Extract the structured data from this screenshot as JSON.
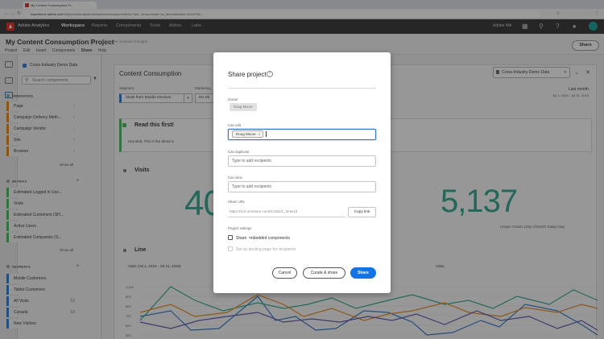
{
  "browser": {
    "tab_title": "My Content Consumption Pr...",
    "url_host": "experience.adobe.com",
    "url_rest": "/#/@adobeanalytics/analytics/workspace/edit/5c74bd...&reportsuite=sc_demodata&ch=5c2a7f3e..."
  },
  "topnav": {
    "brand": "Adobe Analytics",
    "items": [
      "Workspace",
      "Reports",
      "Components",
      "Tools",
      "Admin",
      "Labs"
    ],
    "org": "Adobe MA"
  },
  "project": {
    "title": "My Content Consumption Project",
    "subtitle": "There are unsaved changes",
    "menus": [
      "Project",
      "Edit",
      "Insert",
      "Components",
      "Share",
      "Help"
    ],
    "share_label": "Share"
  },
  "panel": {
    "report_suite": "Cross-Industry Demo Data",
    "search_placeholder": "Search components",
    "dimensions_head": "DIMENSIONS",
    "dimensions": [
      "Page",
      "Campaign Delivery Meth...",
      "Campaign Vendor",
      "Site",
      "Browser"
    ],
    "metrics_head": "METRICS",
    "metrics": [
      "Estimated Logged in Use...",
      "Visits",
      "Estimated Customers (SH...",
      "Active Users",
      "Estimated Companies (S..."
    ],
    "segments_head": "SEGMENTS",
    "segments": [
      "Mobile Customers",
      "Tablet Customers",
      "All Visits",
      "Canada",
      "New Visitors"
    ],
    "segment_counts": [
      "",
      "",
      "53",
      "53",
      ""
    ],
    "show_all": "Show all"
  },
  "freeform": {
    "title": "Content Consumption",
    "segment_label": "Segment",
    "segment_value": "Visits from Mobile Devices",
    "segment2_label": "Marketing",
    "segment2_value": "No Sh",
    "report_suite": "Cross-Industry Demo Data",
    "date_label": "Last month",
    "date_sub": "Jul 1, 2019 - Jul 31, 2019",
    "read_first_title": "Read this first!",
    "read_first_body": "Hey Bob,  This is the about a",
    "visits_title": "Visits",
    "big_left": "40",
    "big_right": "5,137",
    "big_right_sub": "Unique Visitors (Day of Month Today)  Day",
    "line_title": "Line",
    "legend_left": "Visits (Jul 1, 2019 - Jul 31, 2019)",
    "legend_right": "Visits",
    "y_ticks": [
      "1,000",
      "900",
      "800",
      "700",
      "600",
      "500"
    ]
  },
  "modal": {
    "title": "Share project",
    "help": "?",
    "owner_label": "Owner",
    "owner_value": "Doug Moore",
    "can_edit_label": "Can edit",
    "can_edit_tag": "Doug Moore",
    "can_duplicate_label": "Can duplicate",
    "can_duplicate_placeholder": "Type to add recipients",
    "can_view_label": "Can view",
    "can_view_placeholder": "Type to add recipients",
    "share_url_label": "Share URL",
    "share_url_value": "https://sc2.omniture.com/sc15/x/1_3mw1d",
    "copy_link": "Copy link",
    "settings_label": "Project settings",
    "share_embedded": "Share embedded components",
    "set_landing": "Set as landing page for recipients",
    "cancel": "Cancel",
    "curate": "Curate & share",
    "share": "Share"
  },
  "colors": {
    "accent": "#1473e6",
    "metric_green": "#2aa58d",
    "dimension_orange": "#e68619",
    "segment_blue": "#2d75c9"
  }
}
